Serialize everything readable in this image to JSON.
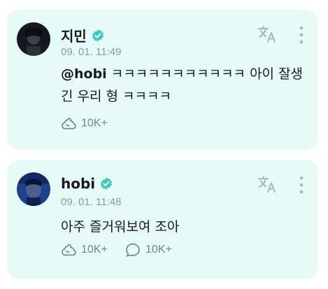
{
  "posts": [
    {
      "author": "지민",
      "verified": true,
      "timestamp": "09. 01. 11:49",
      "mention": "@hobi",
      "text": "ㅋㅋㅋㅋㅋㅋㅋㅋㅋㅋㅋ 아이 잘생긴 우리 형 ㅋㅋㅋㅋ",
      "likes": "10K+"
    },
    {
      "author": "hobi",
      "verified": true,
      "timestamp": "09. 01. 11:48",
      "text": "아주 즐거워보여 조아",
      "likes": "10K+",
      "comments": "10K+"
    }
  ],
  "icons": {
    "verified": "verified-badge-icon",
    "translate": "translate-icon",
    "more": "more-vertical-icon",
    "like": "like-icon",
    "comment": "comment-icon"
  },
  "colors": {
    "card_bg": "#e6fbf7",
    "verified": "#3ec8c0",
    "muted": "#8f9a98"
  }
}
